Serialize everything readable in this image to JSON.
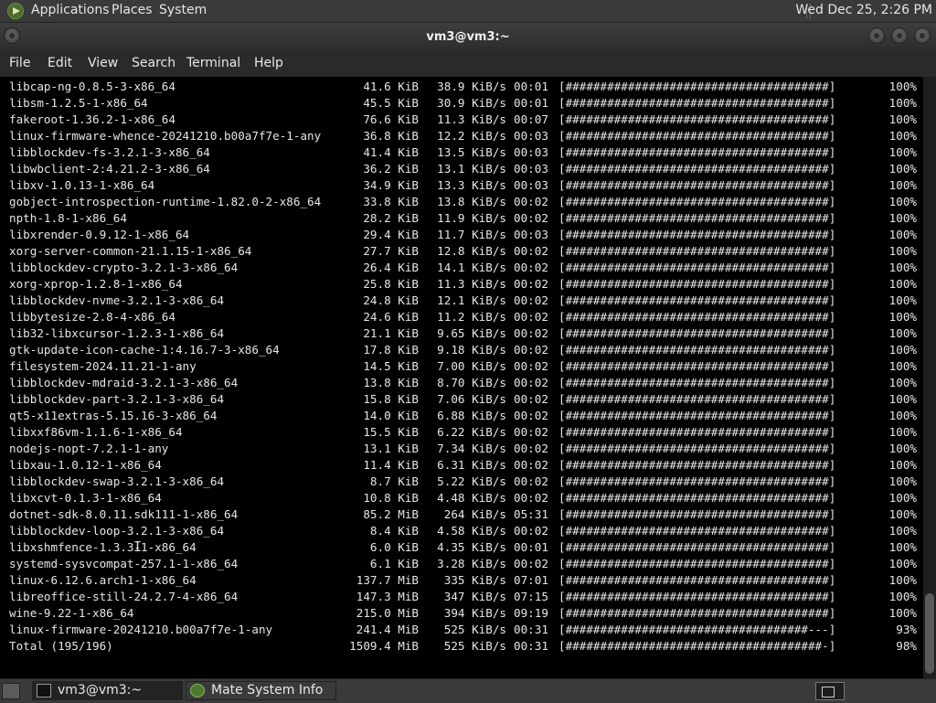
{
  "top_panel": {
    "menus": [
      "Applications",
      "Places",
      "System"
    ],
    "clock": "Wed Dec 25,  2:26 PM"
  },
  "window": {
    "title": "vm3@vm3:~"
  },
  "menubar": [
    "File",
    "Edit",
    "View",
    "Search",
    "Terminal",
    "Help"
  ],
  "terminal": {
    "rows": [
      {
        "name": "libcap-ng-0.8.5-3-x86_64",
        "size": "41.6 KiB",
        "rate": "38.9 KiB/s",
        "time": "00:01",
        "bar": "[######################################]",
        "pct": "100%"
      },
      {
        "name": "libsm-1.2.5-1-x86_64",
        "size": "45.5 KiB",
        "rate": "30.9 KiB/s",
        "time": "00:01",
        "bar": "[######################################]",
        "pct": "100%"
      },
      {
        "name": "fakeroot-1.36.2-1-x86_64",
        "size": "76.6 KiB",
        "rate": "11.3 KiB/s",
        "time": "00:07",
        "bar": "[######################################]",
        "pct": "100%"
      },
      {
        "name": "linux-firmware-whence-20241210.b00a7f7e-1-any",
        "size": "36.8 KiB",
        "rate": "12.2 KiB/s",
        "time": "00:03",
        "bar": "[######################################]",
        "pct": "100%"
      },
      {
        "name": "libblockdev-fs-3.2.1-3-x86_64",
        "size": "41.4 KiB",
        "rate": "13.5 KiB/s",
        "time": "00:03",
        "bar": "[######################################]",
        "pct": "100%"
      },
      {
        "name": "libwbclient-2:4.21.2-3-x86_64",
        "size": "36.2 KiB",
        "rate": "13.1 KiB/s",
        "time": "00:03",
        "bar": "[######################################]",
        "pct": "100%"
      },
      {
        "name": "libxv-1.0.13-1-x86_64",
        "size": "34.9 KiB",
        "rate": "13.3 KiB/s",
        "time": "00:03",
        "bar": "[######################################]",
        "pct": "100%"
      },
      {
        "name": "gobject-introspection-runtime-1.82.0-2-x86_64",
        "size": "33.8 KiB",
        "rate": "13.8 KiB/s",
        "time": "00:02",
        "bar": "[######################################]",
        "pct": "100%"
      },
      {
        "name": "npth-1.8-1-x86_64",
        "size": "28.2 KiB",
        "rate": "11.9 KiB/s",
        "time": "00:02",
        "bar": "[######################################]",
        "pct": "100%"
      },
      {
        "name": "libxrender-0.9.12-1-x86_64",
        "size": "29.4 KiB",
        "rate": "11.7 KiB/s",
        "time": "00:03",
        "bar": "[######################################]",
        "pct": "100%"
      },
      {
        "name": "xorg-server-common-21.1.15-1-x86_64",
        "size": "27.7 KiB",
        "rate": "12.8 KiB/s",
        "time": "00:02",
        "bar": "[######################################]",
        "pct": "100%"
      },
      {
        "name": "libblockdev-crypto-3.2.1-3-x86_64",
        "size": "26.4 KiB",
        "rate": "14.1 KiB/s",
        "time": "00:02",
        "bar": "[######################################]",
        "pct": "100%"
      },
      {
        "name": "xorg-xprop-1.2.8-1-x86_64",
        "size": "25.8 KiB",
        "rate": "11.3 KiB/s",
        "time": "00:02",
        "bar": "[######################################]",
        "pct": "100%"
      },
      {
        "name": "libblockdev-nvme-3.2.1-3-x86_64",
        "size": "24.8 KiB",
        "rate": "12.1 KiB/s",
        "time": "00:02",
        "bar": "[######################################]",
        "pct": "100%"
      },
      {
        "name": "libbytesize-2.8-4-x86_64",
        "size": "24.6 KiB",
        "rate": "11.2 KiB/s",
        "time": "00:02",
        "bar": "[######################################]",
        "pct": "100%"
      },
      {
        "name": "lib32-libxcursor-1.2.3-1-x86_64",
        "size": "21.1 KiB",
        "rate": "9.65 KiB/s",
        "time": "00:02",
        "bar": "[######################################]",
        "pct": "100%"
      },
      {
        "name": "gtk-update-icon-cache-1:4.16.7-3-x86_64",
        "size": "17.8 KiB",
        "rate": "9.18 KiB/s",
        "time": "00:02",
        "bar": "[######################################]",
        "pct": "100%"
      },
      {
        "name": "filesystem-2024.11.21-1-any",
        "size": "14.5 KiB",
        "rate": "7.00 KiB/s",
        "time": "00:02",
        "bar": "[######################################]",
        "pct": "100%"
      },
      {
        "name": "libblockdev-mdraid-3.2.1-3-x86_64",
        "size": "13.8 KiB",
        "rate": "8.70 KiB/s",
        "time": "00:02",
        "bar": "[######################################]",
        "pct": "100%"
      },
      {
        "name": "libblockdev-part-3.2.1-3-x86_64",
        "size": "15.8 KiB",
        "rate": "7.06 KiB/s",
        "time": "00:02",
        "bar": "[######################################]",
        "pct": "100%"
      },
      {
        "name": "qt5-x11extras-5.15.16-3-x86_64",
        "size": "14.0 KiB",
        "rate": "6.88 KiB/s",
        "time": "00:02",
        "bar": "[######################################]",
        "pct": "100%"
      },
      {
        "name": "libxxf86vm-1.1.6-1-x86_64",
        "size": "15.5 KiB",
        "rate": "6.22 KiB/s",
        "time": "00:02",
        "bar": "[######################################]",
        "pct": "100%"
      },
      {
        "name": "nodejs-nopt-7.2.1-1-any",
        "size": "13.1 KiB",
        "rate": "7.34 KiB/s",
        "time": "00:02",
        "bar": "[######################################]",
        "pct": "100%"
      },
      {
        "name": "libxau-1.0.12-1-x86_64",
        "size": "11.4 KiB",
        "rate": "6.31 KiB/s",
        "time": "00:02",
        "bar": "[######################################]",
        "pct": "100%"
      },
      {
        "name": "libblockdev-swap-3.2.1-3-x86_64",
        "size": "8.7 KiB",
        "rate": "5.22 KiB/s",
        "time": "00:02",
        "bar": "[######################################]",
        "pct": "100%"
      },
      {
        "name": "libxcvt-0.1.3-1-x86_64",
        "size": "10.8 KiB",
        "rate": "4.48 KiB/s",
        "time": "00:02",
        "bar": "[######################################]",
        "pct": "100%"
      },
      {
        "name": "dotnet-sdk-8.0.11.sdk111-1-x86_64",
        "size": "85.2 MiB",
        "rate": "264 KiB/s",
        "time": "05:31",
        "bar": "[######################################]",
        "pct": "100%"
      },
      {
        "name": "libblockdev-loop-3.2.1-3-x86_64",
        "size": "8.4 KiB",
        "rate": "4.58 KiB/s",
        "time": "00:02",
        "bar": "[######################################]",
        "pct": "100%"
      },
      {
        "name": "libxshmfence-1.3.3-1-x86_64",
        "size": "6.0 KiB",
        "rate": "4.35 KiB/s",
        "time": "00:01",
        "bar": "[######################################]",
        "pct": "100%"
      },
      {
        "name": "systemd-sysvcompat-257.1-1-x86_64",
        "size": "6.1 KiB",
        "rate": "3.28 KiB/s",
        "time": "00:02",
        "bar": "[######################################]",
        "pct": "100%"
      },
      {
        "name": "linux-6.12.6.arch1-1-x86_64",
        "size": "137.7 MiB",
        "rate": "335 KiB/s",
        "time": "07:01",
        "bar": "[######################################]",
        "pct": "100%"
      },
      {
        "name": "libreoffice-still-24.2.7-4-x86_64",
        "size": "147.3 MiB",
        "rate": "347 KiB/s",
        "time": "07:15",
        "bar": "[######################################]",
        "pct": "100%"
      },
      {
        "name": "wine-9.22-1-x86_64",
        "size": "215.0 MiB",
        "rate": "394 KiB/s",
        "time": "09:19",
        "bar": "[######################################]",
        "pct": "100%"
      },
      {
        "name": "linux-firmware-20241210.b00a7f7e-1-any",
        "size": "241.4 MiB",
        "rate": "525 KiB/s",
        "time": "00:31",
        "bar": "[###################################---]",
        "pct": "93%"
      },
      {
        "name": "Total (195/196)",
        "size": "1509.4 MiB",
        "rate": "525 KiB/s",
        "time": "00:31",
        "bar": "[#####################################-]",
        "pct": "98%"
      }
    ]
  },
  "taskbar": {
    "tasks": [
      "vm3@vm3:~",
      "Mate System Info"
    ]
  },
  "icons": {
    "distro": "mate-logo-icon",
    "terminal": "terminal-icon",
    "system_info": "mate-system-info-icon"
  },
  "colors": {
    "terminal_bg": "#000000",
    "terminal_fg": "#e6e6e6",
    "panel_bg": "#3a3a3a"
  }
}
